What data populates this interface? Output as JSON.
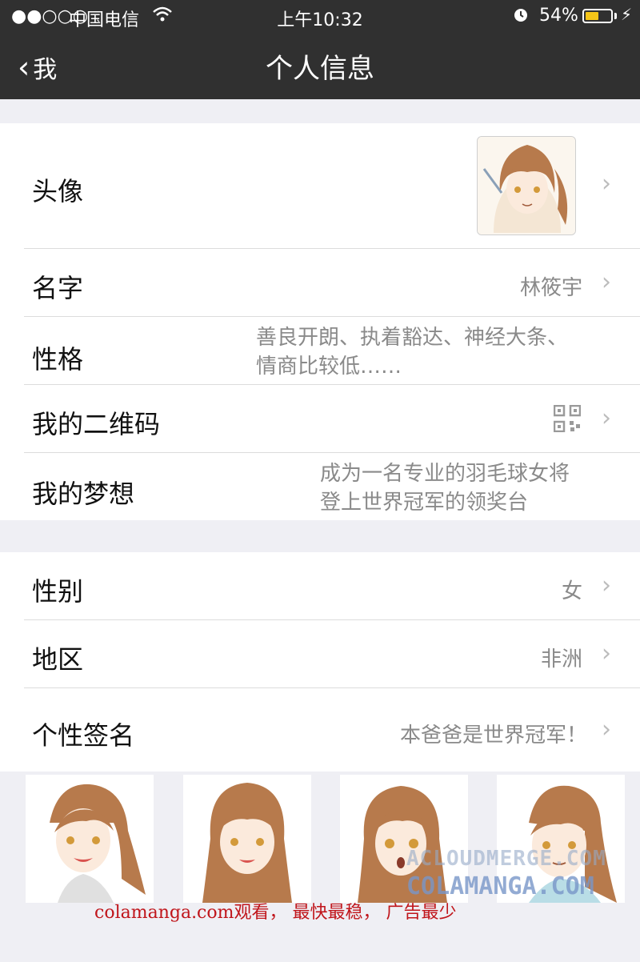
{
  "status_bar": {
    "signal": "●●○○○",
    "carrier": "中国电信",
    "time": "上午10:32",
    "battery_percent": "54%",
    "battery_level": 0.54,
    "battery_color": "#f5c518"
  },
  "nav": {
    "back_label": "我",
    "title": "个人信息"
  },
  "rows": {
    "avatar": {
      "label": "头像"
    },
    "name": {
      "label": "名字",
      "value": "林筱宇"
    },
    "personality": {
      "label": "性格",
      "value_line1": "善良开朗、执着豁达、神经大条、",
      "value_line2": "情商比较低……"
    },
    "qrcode": {
      "label": "我的二维码"
    },
    "dream": {
      "label": "我的梦想",
      "value_line1": "成为一名专业的羽毛球女将",
      "value_line2": "登上世界冠军的领奖台"
    },
    "gender": {
      "label": "性别",
      "value": "女"
    },
    "region": {
      "label": "地区",
      "value": "非洲"
    },
    "signature": {
      "label": "个性签名",
      "value": "本爸爸是世界冠军！"
    }
  },
  "chevron": "›",
  "watermark": {
    "line1": "ACLOUDMERGE.COM",
    "line2": "COLAMANGA.COM"
  },
  "footer_note": "colamanga.com观看， 最快最稳， 广告最少"
}
